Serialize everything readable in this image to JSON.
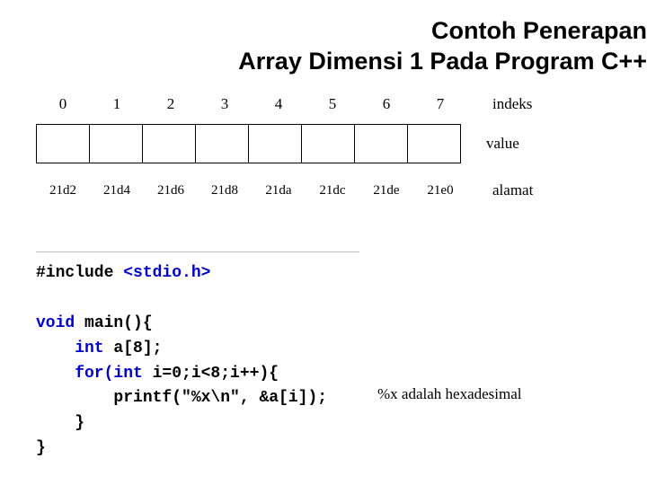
{
  "title_line1": "Contoh Penerapan",
  "title_line2": "Array Dimensi 1 Pada Program C++",
  "labels": {
    "indeks": "indeks",
    "value": "value",
    "alamat": "alamat"
  },
  "indices": [
    "0",
    "1",
    "2",
    "3",
    "4",
    "5",
    "6",
    "7"
  ],
  "addresses": [
    "21d2",
    "21d4",
    "21d6",
    "21d8",
    "21da",
    "21dc",
    "21de",
    "21e0"
  ],
  "code": {
    "l1a": "#include ",
    "l1b": "<stdio.h>",
    "l2": "",
    "l3a": "void ",
    "l3b": "main(){",
    "l4a": "    int ",
    "l4b": "a[8];",
    "l5a": "    for(int ",
    "l5b": "i=0;i<8;i++){",
    "l6": "        printf(\"%x\\n\", &a[i]);",
    "l7": "    }",
    "l8": "}"
  },
  "note": "%x adalah hexadesimal"
}
